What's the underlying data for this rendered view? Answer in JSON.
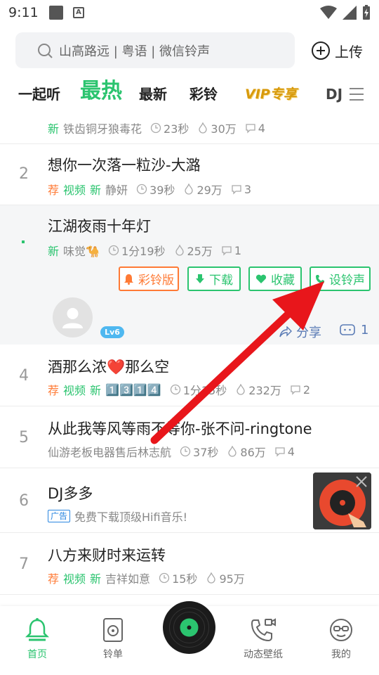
{
  "status": {
    "time": "9:11"
  },
  "search": {
    "placeholder": "山高路远 | 粤语 | 微信铃声"
  },
  "upload": {
    "label": "上传"
  },
  "tabs": [
    "一起听",
    "最热",
    "最新",
    "彩铃",
    "VIP专享",
    "DJ"
  ],
  "songs": [
    {
      "rank": "",
      "title": "",
      "tags": [
        "新"
      ],
      "artist": "铁齿铜牙狼毒花",
      "duration": "23秒",
      "plays": "30万",
      "comments": "4"
    },
    {
      "rank": "2",
      "title": "想你一次落一粒沙-大潞",
      "tags": [
        "荐",
        "视频",
        "新"
      ],
      "artist": "静妍",
      "duration": "39秒",
      "plays": "29万",
      "comments": "3"
    },
    {
      "rank": "",
      "title": "江湖夜雨十年灯",
      "tags": [
        "新"
      ],
      "artist": "味觉🐪",
      "duration": "1分19秒",
      "plays": "25万",
      "comments": "1"
    },
    {
      "rank": "4",
      "title": "酒那么浓❤️那么空",
      "tags": [
        "荐",
        "视频",
        "新"
      ],
      "artist": "1️⃣3️⃣1️⃣4️⃣",
      "duration": "1分15秒",
      "plays": "232万",
      "comments": "2"
    },
    {
      "rank": "5",
      "title": "从此我等风等雨不等你-张不问-ringtone",
      "tags": [],
      "artist": "仙游老板电器售后林志航",
      "duration": "37秒",
      "plays": "86万",
      "comments": "4"
    },
    {
      "rank": "6",
      "title": "DJ多多",
      "tags": [],
      "artist": "",
      "duration": "",
      "plays": "",
      "comments": ""
    },
    {
      "rank": "7",
      "title": "八方来财时来运转",
      "tags": [
        "荐",
        "视频",
        "新"
      ],
      "artist": "吉祥如意",
      "duration": "15秒",
      "plays": "95万",
      "comments": ""
    }
  ],
  "ad": {
    "badge": "广告",
    "text": "免费下载顶级Hifi音乐!"
  },
  "actions": {
    "cailing": "彩铃版",
    "download": "下载",
    "favorite": "收藏",
    "set_ringtone": "设铃声"
  },
  "user": {
    "level": "Lv6"
  },
  "share": {
    "label": "分享",
    "comments": "1"
  },
  "bottom_nav": [
    "首页",
    "铃单",
    "",
    "动态壁纸",
    "我的"
  ],
  "colors": {
    "accent": "#2bc46f",
    "orange": "#ff7a35",
    "arrow": "#e8161b"
  }
}
